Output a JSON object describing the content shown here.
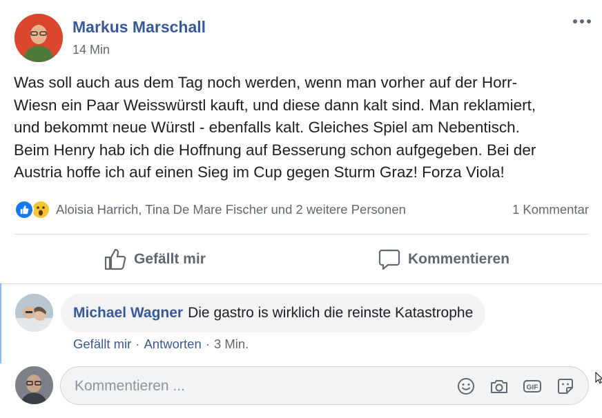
{
  "post": {
    "author": "Markus Marschall",
    "timestamp": "14 Min",
    "text": "Was soll auch aus dem Tag noch werden, wenn man vorher auf der Horr-\nWiesn ein Paar Weisswürstl kauft, und diese dann kalt sind. Man reklamiert,\nund bekommt neue Würstl - ebenfalls kalt. Gleiches Spiel am Nebentisch.\nBeim Henry hab ich die Hoffnung auf Besserung schon aufgegeben. Bei der\nAustria hoffe ich auf einen Sieg im Cup gegen Sturm Graz! Forza Viola!"
  },
  "reactions": {
    "icons": [
      "like-icon",
      "wow-icon"
    ],
    "names": "Aloisia Harrich, Tina De Mare Fischer und 2 weitere Personen",
    "comment_count": "1 Kommentar"
  },
  "actions": {
    "like_label": "Gefällt mir",
    "comment_label": "Kommentieren"
  },
  "comment": {
    "author": "Michael Wagner",
    "text": "Die gastro is wirklich die reinste Katastrophe",
    "like_label": "Gefällt mir",
    "separator": "·",
    "reply_label": "Antworten",
    "time": "3 Min."
  },
  "composer": {
    "placeholder": "Kommentieren ...",
    "icons": [
      "emoji-icon",
      "camera-icon",
      "gif-icon",
      "sticker-icon"
    ]
  },
  "colors": {
    "link_blue": "#385898",
    "meta_gray": "#606770",
    "like_blue": "#1877f2",
    "wow_yellow": "#f7c339",
    "bubble_bg": "#f2f3f5"
  }
}
